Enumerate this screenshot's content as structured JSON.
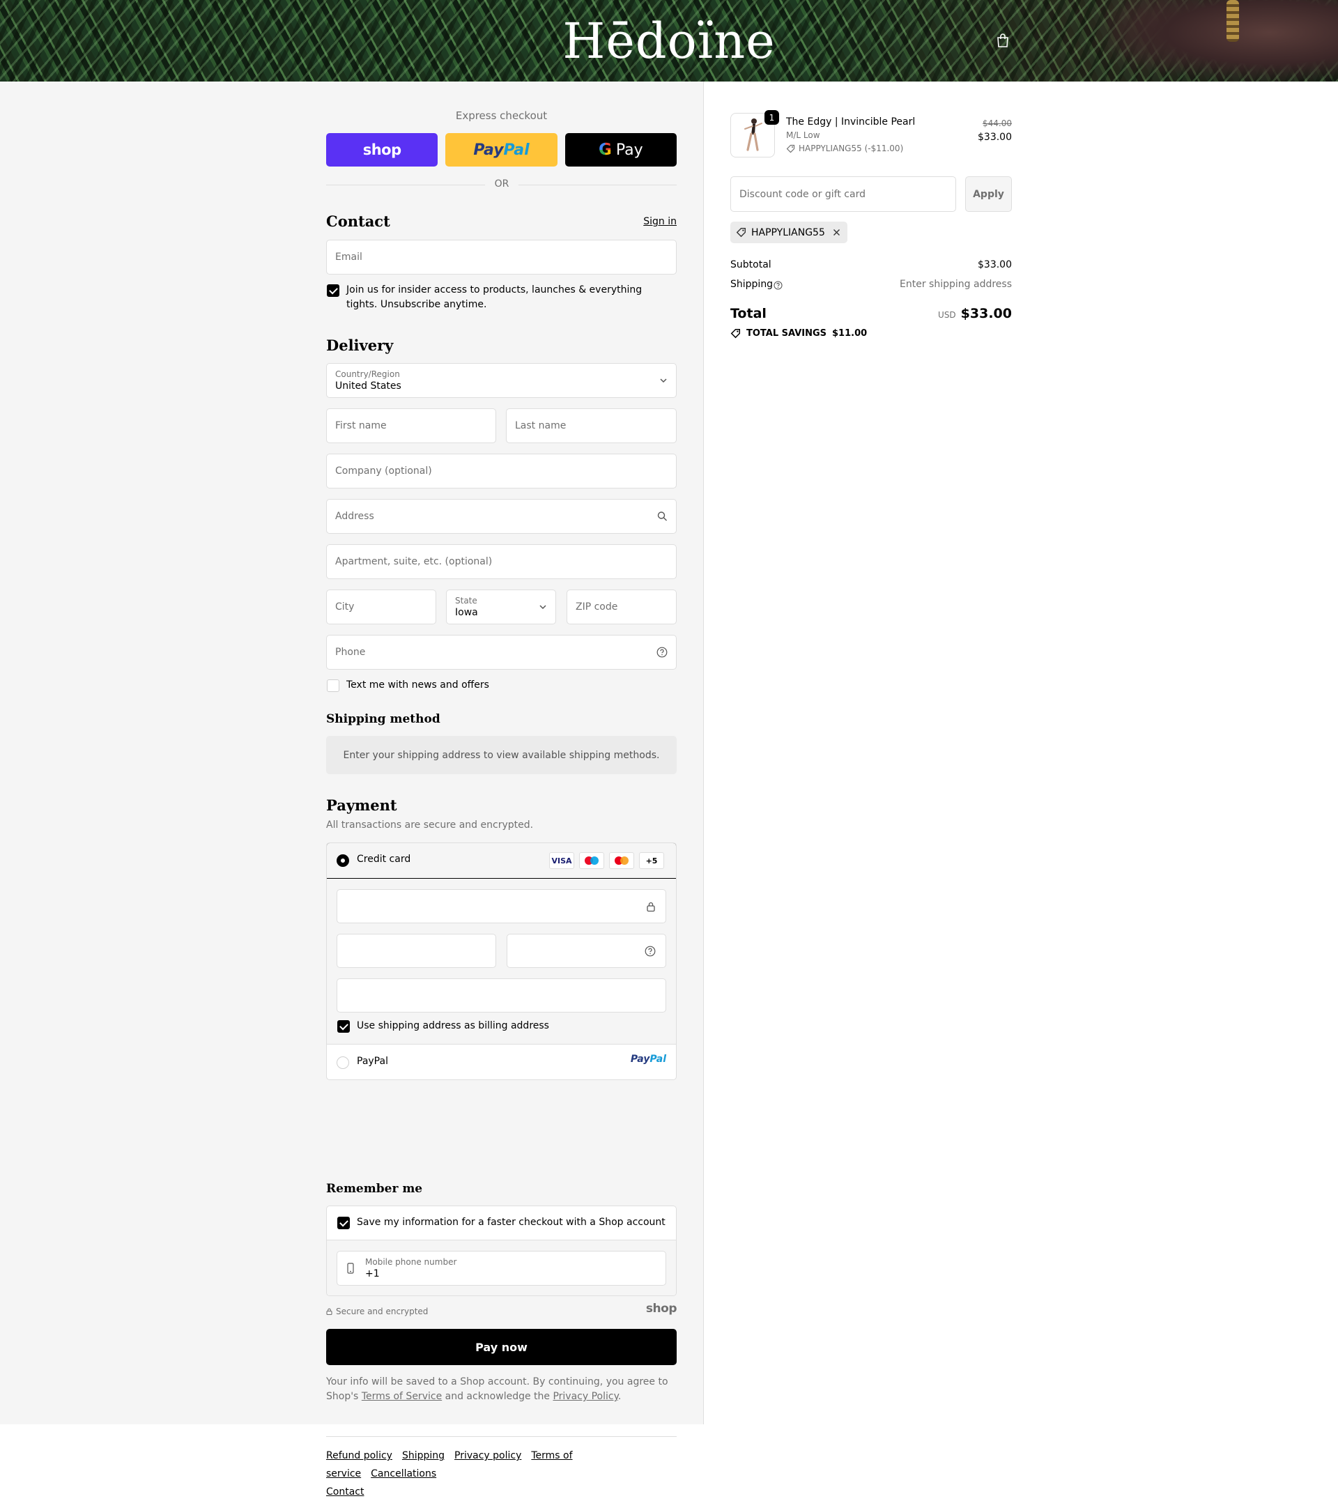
{
  "header": {
    "logo": "Hēdoïne",
    "bag_icon": "shopping-bag-icon"
  },
  "express": {
    "title": "Express checkout",
    "buttons": {
      "shop": "shop",
      "paypal_a": "Pay",
      "paypal_b": "Pal",
      "gpay_g": "G",
      "gpay_label": "Pay"
    },
    "or": "OR"
  },
  "contact": {
    "title": "Contact",
    "sign_in": "Sign in",
    "email_placeholder": "Email",
    "marketing_label": "Join us for insider access to products, launches & everything tights. Unsubscribe anytime.",
    "marketing_checked": true
  },
  "delivery": {
    "title": "Delivery",
    "country_label": "Country/Region",
    "country_value": "United States",
    "first_name": "First name",
    "last_name": "Last name",
    "company": "Company (optional)",
    "address": "Address",
    "apartment": "Apartment, suite, etc. (optional)",
    "city": "City",
    "state_label": "State",
    "state_value": "Iowa",
    "zip": "ZIP code",
    "phone": "Phone",
    "sms_label": "Text me with news and offers",
    "sms_checked": false
  },
  "shipping_method": {
    "title": "Shipping method",
    "message": "Enter your shipping address to view available shipping methods."
  },
  "payment": {
    "title": "Payment",
    "subtitle": "All transactions are secure and encrypted.",
    "credit_card_label": "Credit card",
    "brands": [
      "VISA",
      "",
      "",
      "+5"
    ],
    "billing_label": "Use shipping address as billing address",
    "billing_checked": true,
    "paypal_label": "PayPal",
    "paypal_logo_a": "Pay",
    "paypal_logo_b": "Pal"
  },
  "remember": {
    "title": "Remember me",
    "save_label": "Save my information for a faster checkout with a Shop account",
    "save_checked": true,
    "mobile_label": "Mobile phone number",
    "mobile_value": "+1"
  },
  "secure": {
    "label": "Secure and encrypted",
    "shop_logo": "shop"
  },
  "pay_now": "Pay now",
  "legal": {
    "pre": "Your info will be saved to a Shop account. By continuing, you agree to Shop's ",
    "terms": "Terms of Service",
    "mid": " and acknowledge the ",
    "privacy": "Privacy Policy",
    "post": "."
  },
  "footer": [
    "Refund policy",
    "Shipping",
    "Privacy policy",
    "Terms of service",
    "Cancellations",
    "Contact"
  ],
  "summary": {
    "product": {
      "quantity": "1",
      "name": "The Edgy | Invincible Pearl",
      "variant": "M/L Low",
      "discount": "HAPPYLIANG55 (-$11.00)",
      "original_price": "$44.00",
      "price": "$33.00"
    },
    "discount_placeholder": "Discount code or gift card",
    "apply": "Apply",
    "applied_code": "HAPPYLIANG55",
    "subtotal_label": "Subtotal",
    "subtotal_value": "$33.00",
    "shipping_label": "Shipping",
    "shipping_value": "Enter shipping address",
    "total_label": "Total",
    "currency": "USD",
    "total_value": "$33.00",
    "savings_label": "TOTAL SAVINGS",
    "savings_value": "$11.00"
  }
}
